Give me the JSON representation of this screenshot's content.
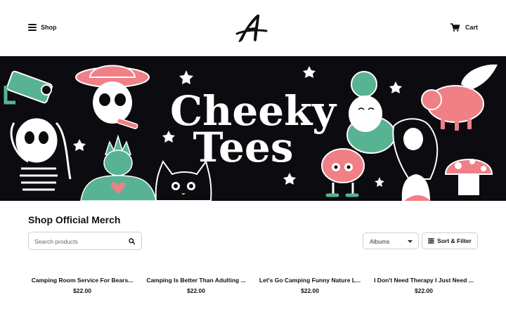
{
  "header": {
    "shop_label": "Shop",
    "cart_label": "Cart",
    "logo_letter": "A"
  },
  "banner": {
    "title_line1": "Cheeky",
    "title_line2": "Tees",
    "colors": {
      "background": "#0b0b10",
      "pink": "#f07f86",
      "teal": "#58b393",
      "white": "#ffffff"
    }
  },
  "main": {
    "title": "Shop Official Merch",
    "search": {
      "placeholder": "Search products",
      "value": ""
    },
    "select": {
      "value": "Albums"
    },
    "filter_label": "Sort & Filter"
  },
  "products": [
    {
      "name": "Camping Room Service For Bears...",
      "price": "$22.00"
    },
    {
      "name": "Camping Is Better Than Adulting ...",
      "price": "$22.00"
    },
    {
      "name": "Let's Go Camping Funny Nature L...",
      "price": "$22.00"
    },
    {
      "name": "I Don't Need Therapy I Just Need ...",
      "price": "$22.00"
    }
  ]
}
